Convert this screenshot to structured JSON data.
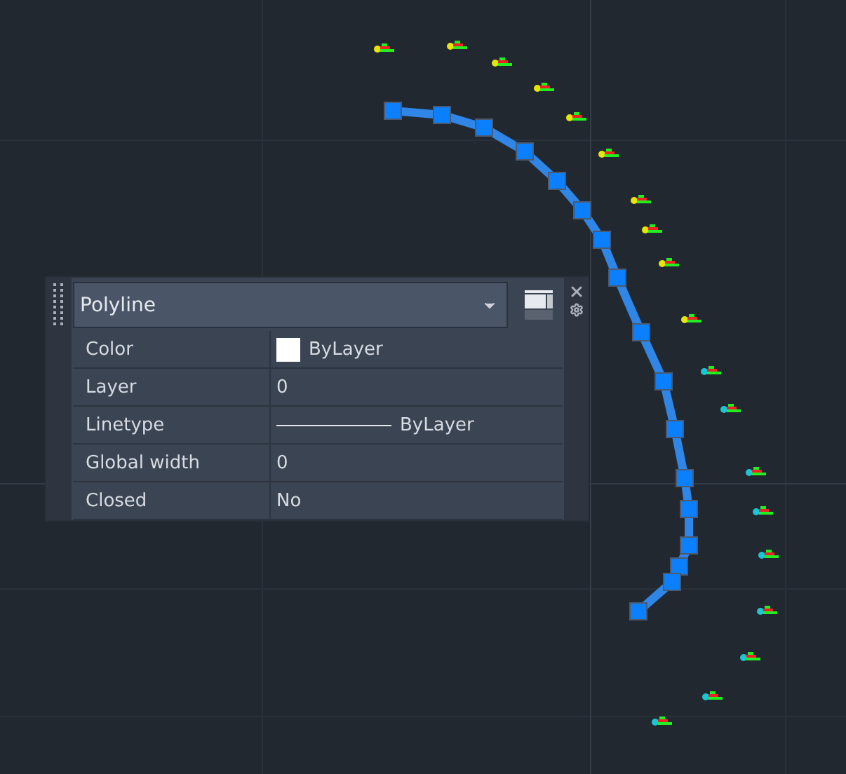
{
  "quick_properties": {
    "object_type": "Polyline",
    "rows": [
      {
        "kind": "color",
        "label": "Color",
        "value": "ByLayer"
      },
      {
        "kind": "text",
        "label": "Layer",
        "value": "0"
      },
      {
        "kind": "linetype",
        "label": "Linetype",
        "value": "ByLayer"
      },
      {
        "kind": "text",
        "label": "Global width",
        "value": "0"
      },
      {
        "kind": "text",
        "label": "Closed",
        "value": "No"
      }
    ]
  }
}
